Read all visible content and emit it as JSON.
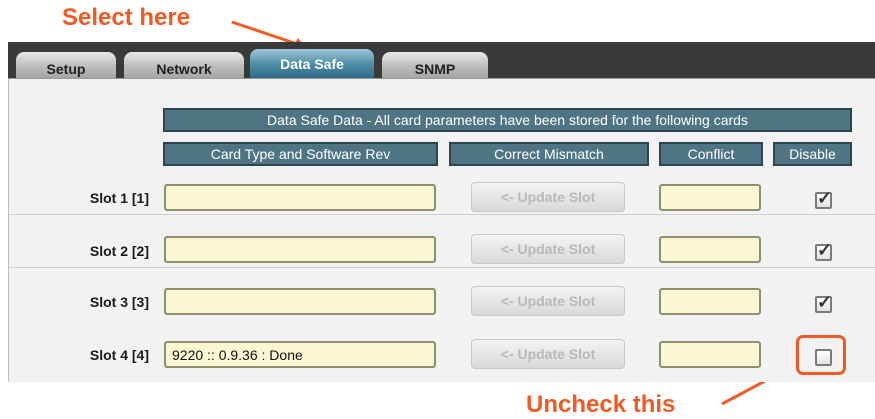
{
  "annotations": {
    "top": "Select here",
    "bottom": "Uncheck this",
    "color": "#f15a22"
  },
  "tabs": [
    {
      "label": "Setup",
      "active": false
    },
    {
      "label": "Network",
      "active": false
    },
    {
      "label": "Data Safe",
      "active": true
    },
    {
      "label": "SNMP",
      "active": false
    }
  ],
  "headers": {
    "banner": "Data Safe Data - All card parameters have been stored for the following cards",
    "card_type": "Card Type and Software Rev",
    "correct_mismatch": "Correct Mismatch",
    "conflict": "Conflict",
    "disable": "Disable"
  },
  "slots": [
    {
      "label": "Slot 1 [1]",
      "card": "",
      "button": "<- Update Slot",
      "conflict": "",
      "disabled_checked": true
    },
    {
      "label": "Slot 2 [2]",
      "card": "",
      "button": "<- Update Slot",
      "conflict": "",
      "disabled_checked": true
    },
    {
      "label": "Slot 3 [3]",
      "card": "",
      "button": "<- Update Slot",
      "conflict": "",
      "disabled_checked": true
    },
    {
      "label": "Slot 4 [4]",
      "card": "9220 :: 0.9.36 : Done",
      "button": "<- Update Slot",
      "conflict": "",
      "disabled_checked": false
    }
  ],
  "icons": {
    "checked": "check-mark",
    "unchecked": "empty-box"
  }
}
